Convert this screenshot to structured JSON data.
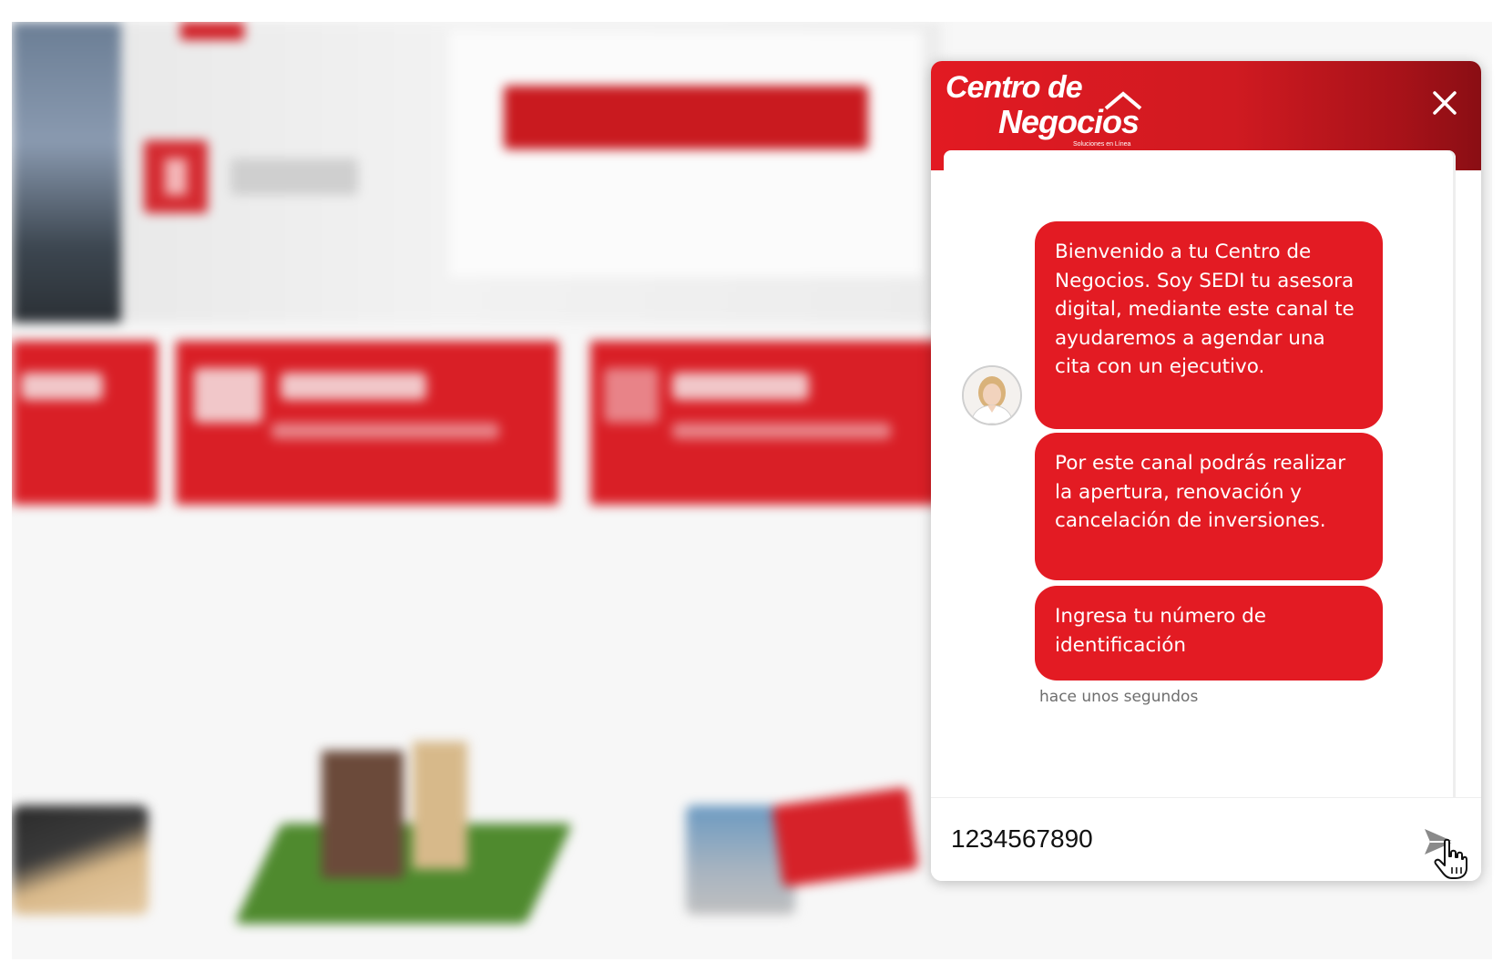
{
  "chat": {
    "logo": {
      "line1": "Centro de",
      "line2": "Negocios",
      "tagline": "Soluciones en Línea"
    },
    "messages": [
      {
        "text": "Bienvenido  a tu Centro de Negocios. Soy SEDI tu asesora digital, mediante este canal te  ayudaremos a agendar una cita con un ejecutivo."
      },
      {
        "text": "Por este canal podrás realizar la apertura, renovación y cancelación de inversiones."
      },
      {
        "text": "Ingresa tu número de identificación"
      }
    ],
    "timestamp": "hace unos segundos",
    "input": {
      "value": "1234567890"
    },
    "icons": {
      "close": "close-icon",
      "send": "send-icon",
      "avatar": "advisor-avatar",
      "cursor": "hand-pointer-cursor"
    },
    "colors": {
      "brand_red": "#e31b23",
      "header_dark_red": "#8a0e14",
      "bubble_text": "#ffffff",
      "timestamp": "#6e6e6e"
    }
  }
}
